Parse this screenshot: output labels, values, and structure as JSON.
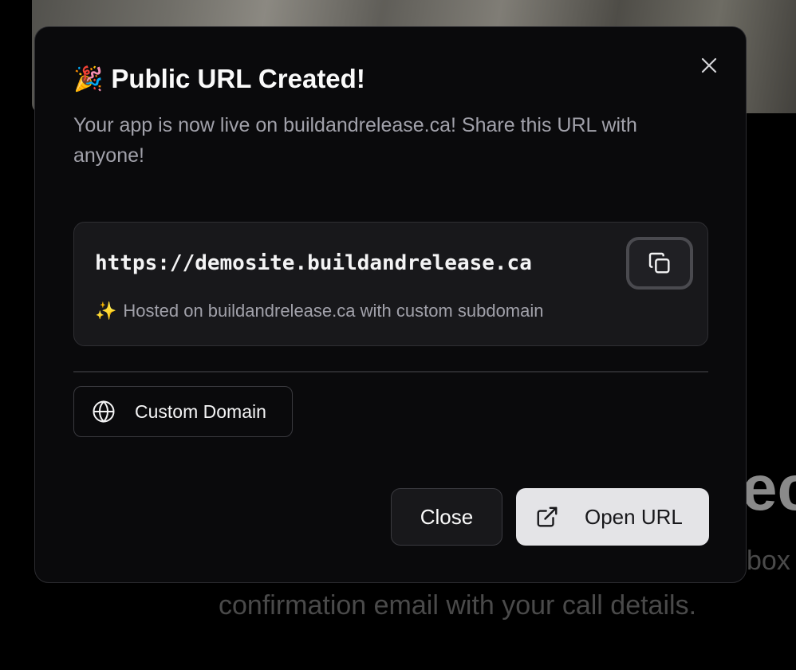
{
  "background": {
    "heading_fragment": "ec",
    "line1_fragment": "box",
    "line2": "confirmation email with your call details."
  },
  "modal": {
    "title_emoji": "🎉",
    "title": "Public URL Created!",
    "subtitle": "Your app is now live on buildandrelease.ca! Share this URL with anyone!",
    "url": "https://demosite.buildandrelease.ca",
    "hosted_emoji": "✨",
    "hosted_note": "Hosted on buildandrelease.ca with custom subdomain",
    "custom_domain_label": "Custom Domain",
    "close_label": "Close",
    "open_url_label": "Open URL"
  },
  "icons": {
    "close": "close-icon",
    "copy": "copy-icon",
    "globe": "globe-icon",
    "external_link": "external-link-icon"
  },
  "colors": {
    "modal_bg": "#0a0a0c",
    "card_bg": "#18181b",
    "primary_button_bg": "#e4e4e7",
    "muted_text": "#a1a1aa"
  }
}
